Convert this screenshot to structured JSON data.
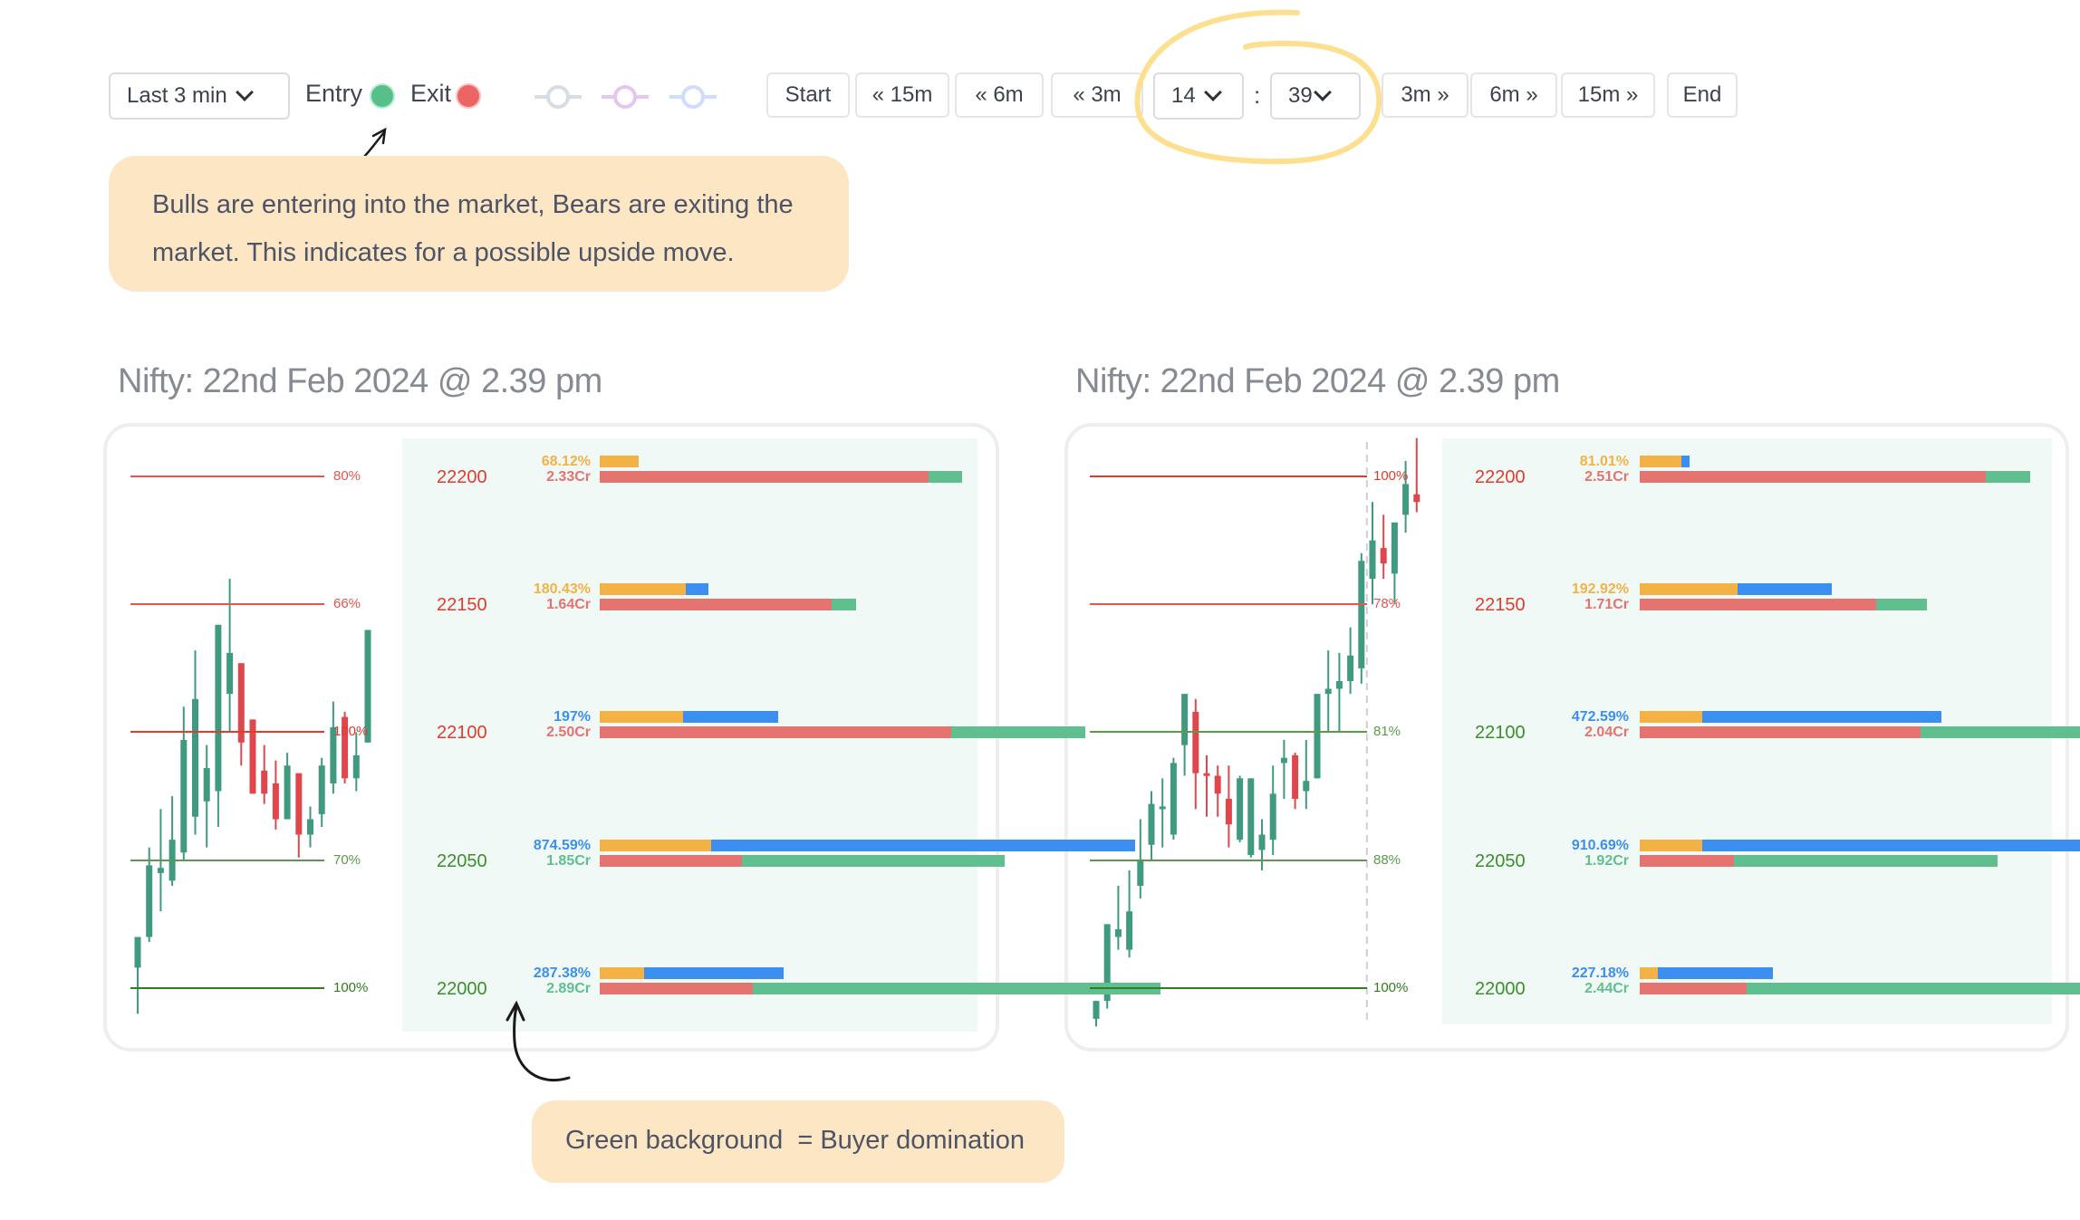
{
  "toolbar": {
    "range_dropdown": {
      "label": "Last 3 min"
    },
    "entry_label": "Entry",
    "exit_label": "Exit",
    "entry_color": "#57c08a",
    "exit_color": "#ec6464",
    "ring_icons": [
      {
        "name": "ring-gray-icon",
        "color": "#d6dde4"
      },
      {
        "name": "ring-purple-icon",
        "color": "#e4c6ef"
      },
      {
        "name": "ring-blue-icon",
        "color": "#cfdcff"
      }
    ],
    "nav_back": [
      {
        "label": "Start"
      },
      {
        "label": "« 15m"
      },
      {
        "label": "« 6m"
      },
      {
        "label": "« 3m"
      }
    ],
    "hour_select": {
      "value": "14"
    },
    "time_separator": ":",
    "minute_select": {
      "value": "39"
    },
    "nav_forward": [
      {
        "label": "3m »"
      },
      {
        "label": "6m »"
      },
      {
        "label": "15m »"
      },
      {
        "label": "End"
      }
    ]
  },
  "callouts": {
    "top": "Bulls are entering into the market, Bears are exiting the market. This indicates for a possible upside move.",
    "bottom": "Green background  = Buyer domination"
  },
  "colors": {
    "bull": "#3f9a80",
    "bear": "#e0474c",
    "orange": "#f4b244",
    "blue": "#3b8ff0",
    "red_bar": "#e5736f",
    "green_bar": "#5fbf8f",
    "panel_bg": "#f1f9f7",
    "resist_line": "#e9554e",
    "support_line": "#4a8f3a",
    "callout_bg": "#fde6c4"
  },
  "chart_data": [
    {
      "type": "bar",
      "title": "Nifty: 22nd Feb 2024 @ 2.39 pm",
      "levels": [
        {
          "strike": "22200",
          "side": "resistance",
          "pct_label": "80%"
        },
        {
          "strike": "22150",
          "side": "resistance",
          "pct_label": "66%"
        },
        {
          "strike": "22100",
          "side": "resistance",
          "pct_label": "100%"
        },
        {
          "strike": "22050",
          "side": "support",
          "pct_label": "70%"
        },
        {
          "strike": "22000",
          "side": "support",
          "pct_label": "100%"
        }
      ],
      "rows": [
        {
          "strike": "22200",
          "change_label": "68.12%",
          "change_color": "orange",
          "oi_label": "2.33Cr",
          "oi_color": "red",
          "change_bar": {
            "orange": 0.07,
            "blue": 0
          },
          "oi_bar": {
            "red": 0.59,
            "green": 0.06
          }
        },
        {
          "strike": "22150",
          "change_label": "180.43%",
          "change_color": "orange",
          "oi_label": "1.64Cr",
          "oi_color": "red",
          "change_bar": {
            "orange": 0.155,
            "blue": 0.04
          },
          "oi_bar": {
            "red": 0.415,
            "green": 0.045
          }
        },
        {
          "strike": "22100",
          "change_label": "197%",
          "change_color": "blue",
          "oi_label": "2.50Cr",
          "oi_color": "red",
          "change_bar": {
            "orange": 0.15,
            "blue": 0.17
          },
          "oi_bar": {
            "red": 0.63,
            "green": 0.24
          }
        },
        {
          "strike": "22050",
          "change_label": "874.59%",
          "change_color": "blue",
          "oi_label": "1.85Cr",
          "oi_color": "green",
          "change_bar": {
            "orange": 0.2,
            "blue": 0.76
          },
          "oi_bar": {
            "red": 0.255,
            "green": 0.47
          }
        },
        {
          "strike": "22000",
          "change_label": "287.38%",
          "change_color": "blue",
          "oi_label": "2.89Cr",
          "oi_color": "green",
          "change_bar": {
            "orange": 0.08,
            "blue": 0.25
          },
          "oi_bar": {
            "red": 0.275,
            "green": 0.73
          }
        }
      ],
      "candles": [
        [
          22008,
          22020,
          21990,
          22020
        ],
        [
          22020,
          22055,
          22018,
          22048
        ],
        [
          22045,
          22070,
          22030,
          22047
        ],
        [
          22042,
          22075,
          22040,
          22058
        ],
        [
          22053,
          22110,
          22050,
          22097
        ],
        [
          22067,
          22132,
          22060,
          22113
        ],
        [
          22073,
          22095,
          22055,
          22086
        ],
        [
          22077,
          22142,
          22063,
          22142
        ],
        [
          22115,
          22160,
          22100,
          22131
        ],
        [
          22127,
          22123,
          22087,
          22096
        ],
        [
          22105,
          22105,
          22085,
          22076
        ],
        [
          22085,
          22095,
          22072,
          22076
        ],
        [
          22080,
          22089,
          22062,
          22066
        ],
        [
          22066,
          22092,
          22067,
          22087
        ],
        [
          22084,
          22080,
          22051,
          22060
        ],
        [
          22060,
          22071,
          22055,
          22066
        ],
        [
          22068,
          22090,
          22063,
          22087
        ],
        [
          22080,
          22112,
          22076,
          22102
        ],
        [
          22106,
          22108,
          22080,
          22082
        ],
        [
          22082,
          22100,
          22077,
          22091
        ],
        [
          22096,
          22130,
          22096,
          22140
        ]
      ],
      "price_range": [
        21985,
        22205
      ]
    },
    {
      "type": "bar",
      "title": "Nifty: 22nd Feb 2024 @ 2.39 pm",
      "levels": [
        {
          "strike": "22200",
          "side": "resistance",
          "pct_label": "100%"
        },
        {
          "strike": "22150",
          "side": "resistance",
          "pct_label": "78%"
        },
        {
          "strike": "22100",
          "side": "support",
          "pct_label": "81%"
        },
        {
          "strike": "22050",
          "side": "support",
          "pct_label": "88%"
        },
        {
          "strike": "22000",
          "side": "support",
          "pct_label": "100%"
        }
      ],
      "rows": [
        {
          "strike": "22200",
          "change_label": "81.01%",
          "change_color": "orange",
          "oi_label": "2.51Cr",
          "oi_color": "red",
          "change_bar": {
            "orange": 0.07,
            "blue": 0.015
          },
          "oi_bar": {
            "red": 0.585,
            "green": 0.075
          }
        },
        {
          "strike": "22150",
          "change_label": "192.92%",
          "change_color": "orange",
          "oi_label": "1.71Cr",
          "oi_color": "red",
          "change_bar": {
            "orange": 0.165,
            "blue": 0.16
          },
          "oi_bar": {
            "red": 0.4,
            "green": 0.085
          }
        },
        {
          "strike": "22100",
          "change_label": "472.59%",
          "change_color": "blue",
          "oi_label": "2.04Cr",
          "oi_color": "red",
          "change_bar": {
            "orange": 0.105,
            "blue": 0.405
          },
          "oi_bar": {
            "red": 0.475,
            "green": 0.43
          }
        },
        {
          "strike": "22050",
          "change_label": "910.69%",
          "change_color": "blue",
          "oi_label": "1.92Cr",
          "oi_color": "green",
          "change_bar": {
            "orange": 0.105,
            "blue": 0.785
          },
          "oi_bar": {
            "red": 0.16,
            "green": 0.445
          }
        },
        {
          "strike": "22000",
          "change_label": "227.18%",
          "change_color": "blue",
          "oi_label": "2.44Cr",
          "oi_color": "green",
          "change_bar": {
            "orange": 0.03,
            "blue": 0.195
          },
          "oi_bar": {
            "red": 0.18,
            "green": 0.57
          }
        }
      ],
      "candles": [
        [
          21988,
          21995,
          21985,
          21995
        ],
        [
          21995,
          22025,
          21992,
          22025
        ],
        [
          22020,
          22040,
          22015,
          22023
        ],
        [
          22015,
          22046,
          22012,
          22030
        ],
        [
          22040,
          22066,
          22035,
          22050
        ],
        [
          22056,
          22077,
          22050,
          22072
        ],
        [
          22070,
          22082,
          22055,
          22071
        ],
        [
          22060,
          22090,
          22058,
          22088
        ],
        [
          22095,
          22115,
          22083,
          22115
        ],
        [
          22108,
          22113,
          22070,
          22084
        ],
        [
          22084,
          22091,
          22067,
          22083
        ],
        [
          22083,
          22087,
          22067,
          22076
        ],
        [
          22074,
          22087,
          22055,
          22064
        ],
        [
          22058,
          22083,
          22057,
          22082
        ],
        [
          22052,
          22073,
          22051,
          22082
        ],
        [
          22054,
          22066,
          22046,
          22060
        ],
        [
          22058,
          22087,
          22052,
          22076
        ],
        [
          22088,
          22097,
          22074,
          22090
        ],
        [
          22091,
          22092,
          22070,
          22074
        ],
        [
          22077,
          22097,
          22070,
          22081
        ],
        [
          22082,
          22115,
          22082,
          22115
        ],
        [
          22115,
          22132,
          22100,
          22117
        ],
        [
          22117,
          22131,
          22100,
          22120
        ],
        [
          22120,
          22141,
          22115,
          22130
        ],
        [
          22125,
          22170,
          22119,
          22167
        ],
        [
          22160,
          22190,
          22150,
          22175
        ],
        [
          22172,
          22185,
          22160,
          22166
        ],
        [
          22162,
          22180,
          22150,
          22182
        ],
        [
          22185,
          22206,
          22178,
          22197
        ],
        [
          22193,
          22215,
          22186,
          22190
        ]
      ],
      "price_range": [
        21985,
        22210
      ],
      "dashed_marker_index": 24
    }
  ]
}
